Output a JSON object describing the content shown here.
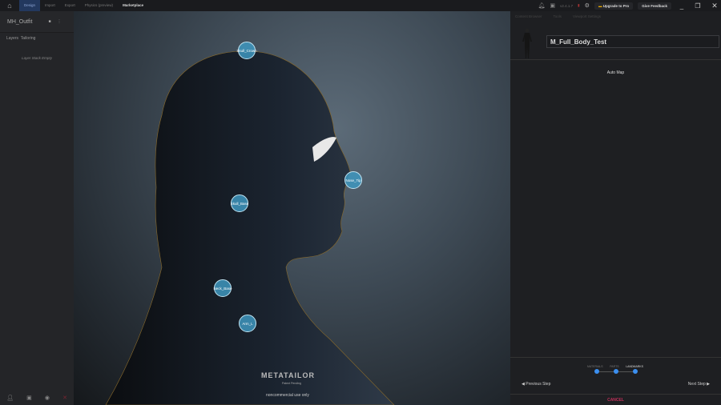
{
  "topbar": {
    "tabs": [
      "Design",
      "Import",
      "Export",
      "Physics (preview)",
      "Marketplace"
    ],
    "version": "v2.4.1.7",
    "upgrade": "Upgrade to Pro",
    "feedback": "Give Feedback"
  },
  "left_panel": {
    "title": "MH_Outfit",
    "tabs": [
      "Layers",
      "Tailoring"
    ],
    "empty": "Layer Stack Empty"
  },
  "viewport": {
    "landmarks": [
      "Skull_Crown",
      "Nose_Tip",
      "Skull_Base",
      "Neck_Base",
      "Arm_L"
    ],
    "logo": "METATAILOR",
    "logo_sub": "Patent Pending",
    "notice": "noncommercial use only"
  },
  "right_panel": {
    "tabs": [
      "Content Browser",
      "Tools",
      "Viewport Settings"
    ],
    "model_name": "M_Full_Body_Test",
    "auto_map": "Auto Map",
    "steps": [
      "MATERIALS",
      "PARTS",
      "LANDMARKS"
    ],
    "prev": "Previous Step",
    "next": "Next Step",
    "cancel": "CANCEL"
  },
  "colors": {
    "accent": "#3b8ff0",
    "cancel": "#c0305a",
    "active_tab": "#23385e"
  }
}
